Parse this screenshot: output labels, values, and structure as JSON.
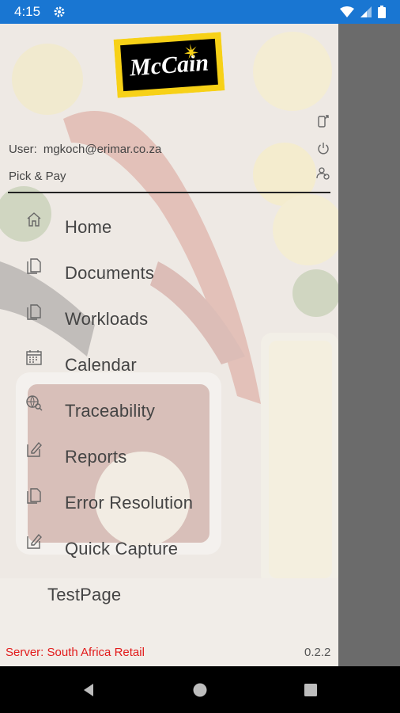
{
  "status_bar": {
    "time": "4:15",
    "color": "#1976d2",
    "icons": [
      "settings-gear-icon",
      "wifi-icon",
      "cellular-icon",
      "battery-icon"
    ]
  },
  "drawer": {
    "logo_text": "McCain",
    "user_label": "User:",
    "user_value": "mgkoch@erimar.co.za",
    "organization": "Pick & Pay",
    "header_icons": [
      "phone-icon",
      "power-icon",
      "switch-user-icon"
    ],
    "menu": [
      {
        "label": "Home",
        "icon": "home-icon"
      },
      {
        "label": "Documents",
        "icon": "documents-icon"
      },
      {
        "label": "Workloads",
        "icon": "documents-icon"
      },
      {
        "label": "Calendar",
        "icon": "calendar-icon"
      },
      {
        "label": "Traceability",
        "icon": "traceability-search-icon"
      },
      {
        "label": "Reports",
        "icon": "edit-report-icon"
      },
      {
        "label": "Error Resolution",
        "icon": "documents-icon"
      },
      {
        "label": "Quick Capture",
        "icon": "edit-report-icon"
      },
      {
        "label": "TestPage",
        "icon": ""
      }
    ],
    "server": "Server: South Africa Retail",
    "version": "0.2.2",
    "server_color": "#e21b1b"
  },
  "nav_bar": {
    "buttons": [
      "back-icon",
      "home-circle-icon",
      "recents-square-icon"
    ]
  }
}
